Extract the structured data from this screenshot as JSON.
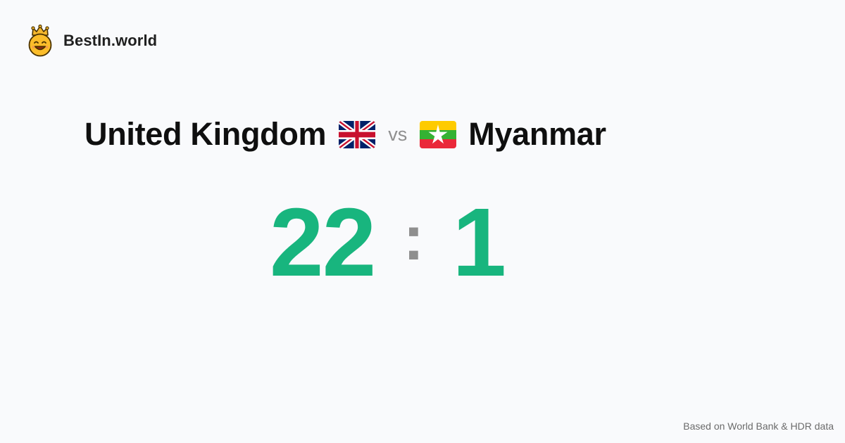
{
  "brand": {
    "name": "BestIn.world",
    "logo_icon": "crowned-smiley-icon"
  },
  "matchup": {
    "left_country": "United Kingdom",
    "left_flag_icon": "uk-flag-icon",
    "vs_label": "vs",
    "right_country": "Myanmar",
    "right_flag_icon": "myanmar-flag-icon"
  },
  "score": {
    "left_value": "22",
    "separator": ":",
    "right_value": "1"
  },
  "footer": {
    "source_note": "Based on World Bank & HDR data"
  },
  "colors": {
    "background": "#f9fafc",
    "score_green": "#18b57e",
    "muted_gray": "#8f8f8f",
    "flag_uk_blue": "#012169",
    "flag_uk_red": "#C8102E",
    "flag_mm_yellow": "#FECB00",
    "flag_mm_green": "#34B233",
    "flag_mm_red": "#EA2839"
  }
}
